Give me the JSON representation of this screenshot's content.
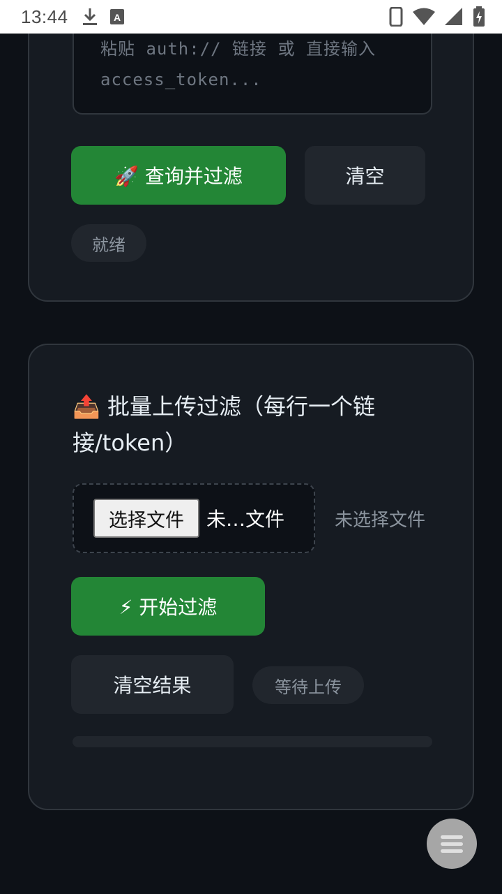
{
  "status_bar": {
    "time": "13:44",
    "icons": [
      "download-icon",
      "keyboard-a-icon",
      "phone-icon",
      "wifi-icon",
      "signal-icon",
      "battery-charging-icon"
    ]
  },
  "query_card": {
    "textarea_placeholder": "粘贴 auth:// 链接 或 直接输入 access_token...",
    "query_button": "🚀 查询并过滤",
    "clear_button": "清空",
    "status_badge": "就绪"
  },
  "upload_card": {
    "title": "📤 批量上传过滤（每行一个链接/token）",
    "file_button": "选择文件",
    "file_name": "未…文件",
    "file_status": "未选择文件",
    "start_button": "⚡ 开始过滤",
    "clear_results_button": "清空结果",
    "status_badge": "等待上传",
    "progress": 0
  },
  "fab": {
    "icon": "menu-icon"
  },
  "colors": {
    "background": "#0d1117",
    "card": "#161b22",
    "accent_green": "#238636"
  }
}
